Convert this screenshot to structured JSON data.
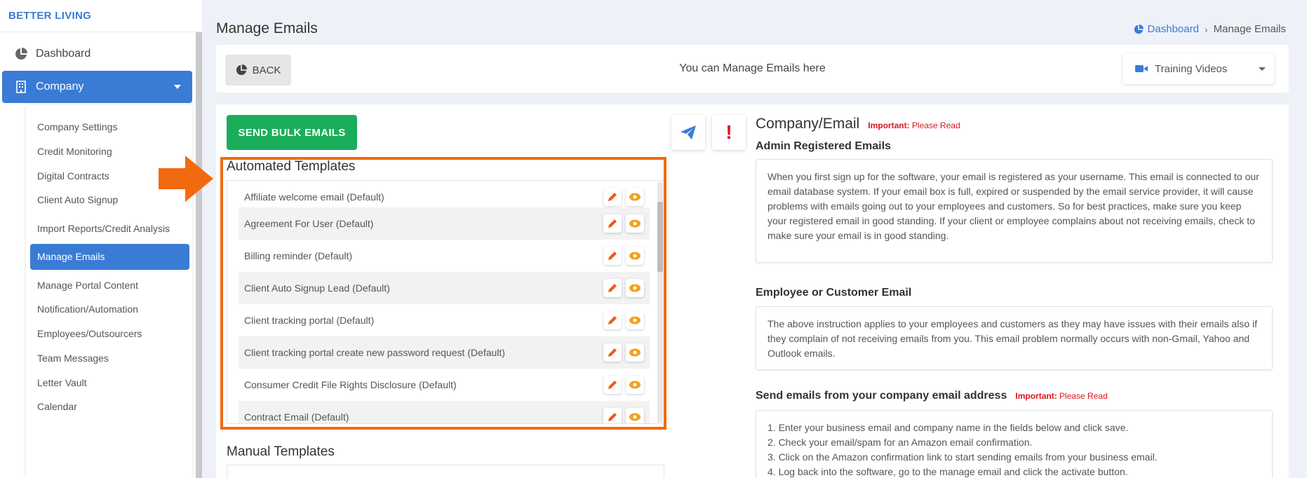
{
  "brand": "BETTER LIVING",
  "nav": {
    "dashboard": "Dashboard",
    "company": "Company"
  },
  "submenu": [
    "Company Settings",
    "Credit Monitoring",
    "Digital Contracts",
    "Client Auto Signup",
    "Import Reports/Credit Analysis",
    "Manage Emails",
    "Manage Portal Content",
    "Notification/Automation",
    "Employees/Outsourcers",
    "Team Messages",
    "Letter Vault",
    "Calendar"
  ],
  "submenu_active": "Manage Emails",
  "page_title": "Manage Emails",
  "breadcrumb": {
    "home": "Dashboard",
    "current": "Manage Emails"
  },
  "toolbar": {
    "back_label": "BACK",
    "message": "You can Manage Emails here",
    "training_label": "Training Videos"
  },
  "bulk_button": "SEND BULK EMAILS",
  "alert_symbol": "!",
  "automated_title": "Automated Templates",
  "automated_templates": [
    "Affiliate welcome email (Default)",
    "Agreement For User (Default)",
    "Billing reminder (Default)",
    "Client Auto Signup Lead (Default)",
    "Client tracking portal (Default)",
    "Client tracking portal create new password request (Default)",
    "Consumer Credit File Rights Disclosure (Default)",
    "Contract Email (Default)"
  ],
  "manual_title": "Manual Templates",
  "right": {
    "title": "Company/Email",
    "important_label": "Important:",
    "important_text": "Please Read",
    "admin_title": "Admin Registered Emails",
    "admin_text": "When you first sign up for the software, your email is registered as your username. This email is connected to our email database system. If your email box is full, expired or suspended by the email service provider, it will cause problems with emails going out to your employees and customers. So for best practices, make sure you keep your registered email in good standing. If your client or employee complains about not receiving emails, check to make sure your email is in good standing.",
    "employee_title": "Employee or Customer Email",
    "employee_text": "The above instruction applies to your employees and customers as they may have issues with their emails also if they complain of not receiving emails from you. This email problem normally occurs with non-Gmail, Yahoo and Outlook emails.",
    "send_title": "Send emails from your company email address",
    "steps": [
      "1. Enter your business email and company name in the fields below and click save.",
      "2. Check your email/spam for an Amazon email confirmation.",
      "3. Click on the Amazon confirmation link to start sending emails from your business email.",
      "4. Log back into the software, go to the manage email and click the activate button."
    ]
  },
  "colors": {
    "primary": "#3a7bd5",
    "success": "#1aae5a",
    "danger": "#e0141e",
    "highlight": "#f26a10",
    "edit_icon": "#f05a14",
    "view_icon": "#f2a21e"
  }
}
